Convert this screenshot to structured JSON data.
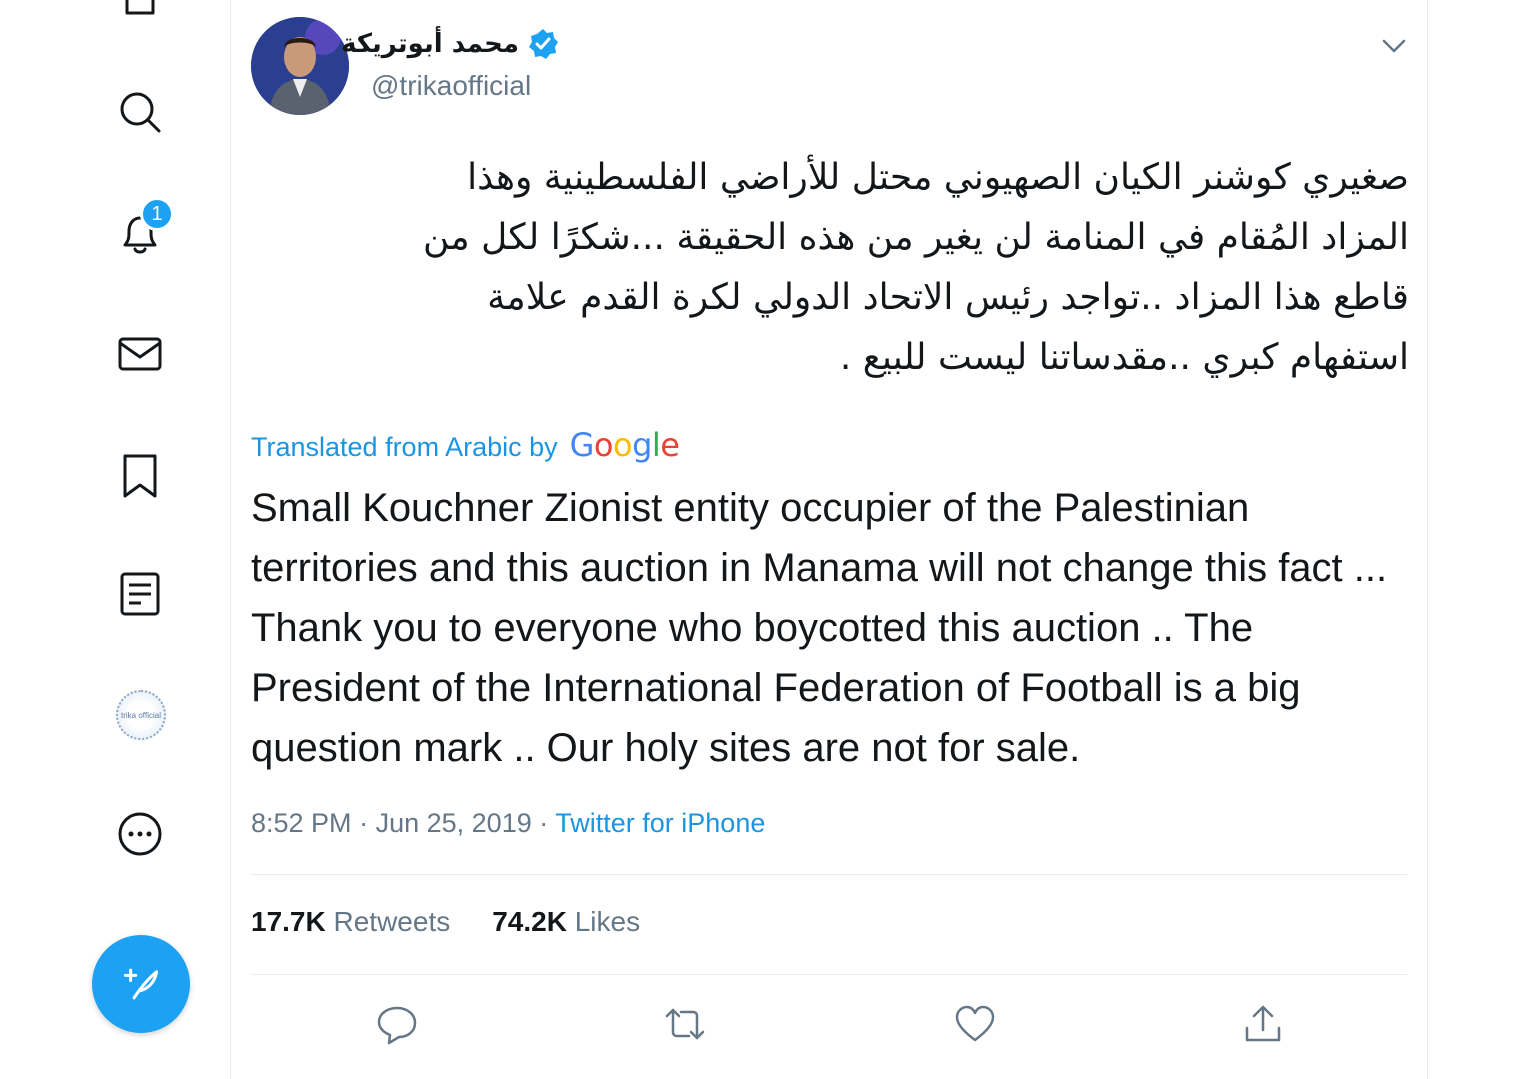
{
  "sidebar": {
    "items": [
      {
        "name": "search"
      },
      {
        "name": "notifications",
        "badge": "1"
      },
      {
        "name": "messages"
      },
      {
        "name": "bookmarks"
      },
      {
        "name": "lists"
      },
      {
        "name": "profile"
      },
      {
        "name": "more"
      }
    ],
    "profile_avatar_text": "trika ofﬁcial",
    "notifications_badge": "1"
  },
  "tweet": {
    "author": {
      "display_name": "محمد أبوتريكة",
      "handle": "@trikaofficial",
      "verified": true
    },
    "text_lines": [
      "صغيري كوشنر الكيان الصهيوني محتل للأراضي الفلسطينية وهذا",
      "المزاد المُقام في المنامة لن يغير من هذه الحقيقة ...شكرًا لكل من",
      "قاطع هذا المزاد ..تواجد رئيس الاتحاد الدولي لكرة القدم علامة",
      "استفهام كبري ..مقدساتنا ليست للبيع ."
    ],
    "translated_label": "Translated from Arabic by",
    "translation_provider": "Google",
    "translation": "Small Kouchner Zionist entity occupier of the Palestinian territories and this auction in Manama will not change this fact ... Thank you to everyone who boycotted this auction .. The President of the International Federation of Football is a big question mark .. Our holy sites are not for sale.",
    "time": "8:52 PM",
    "separator": "·",
    "date": "Jun 25, 2019",
    "source": "Twitter for iPhone",
    "retweets_count": "17.7K",
    "retweets_label": "Retweets",
    "likes_count": "74.2K",
    "likes_label": "Likes"
  },
  "colors": {
    "accent": "#1da1f2",
    "link": "#1b95e0",
    "secondary_text": "#657786",
    "border": "#e6ecf0",
    "primary_text": "#14171a"
  }
}
